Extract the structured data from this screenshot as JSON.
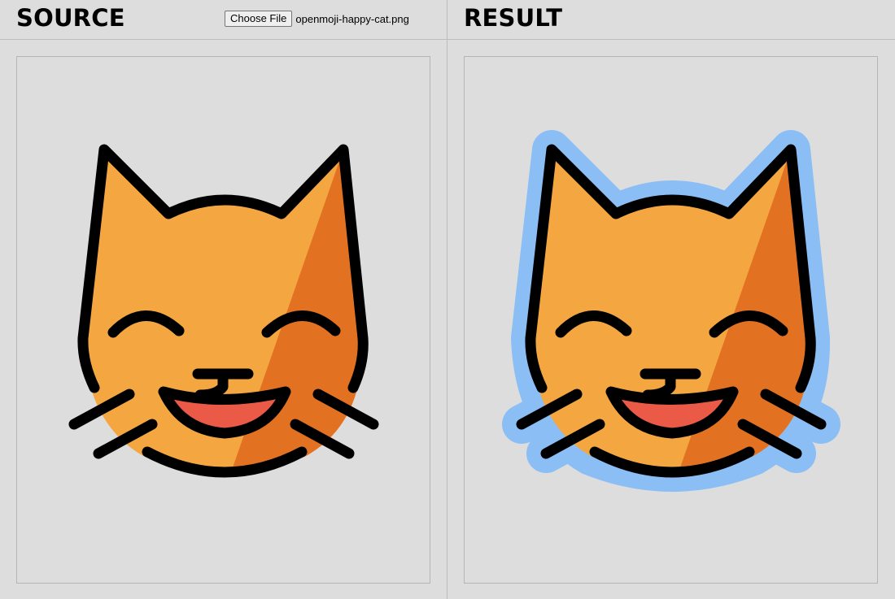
{
  "source": {
    "title": "SOURCE",
    "file_button_label": "Choose File",
    "file_name": "openmoji-happy-cat.png"
  },
  "result": {
    "title": "RESULT"
  },
  "image": {
    "subject": "happy-cat-icon",
    "colors": {
      "outline": "#000000",
      "fur_light": "#F4A740",
      "fur_dark": "#E27222",
      "mouth": "#EA5A47",
      "result_halo": "#8BBEF5"
    }
  }
}
